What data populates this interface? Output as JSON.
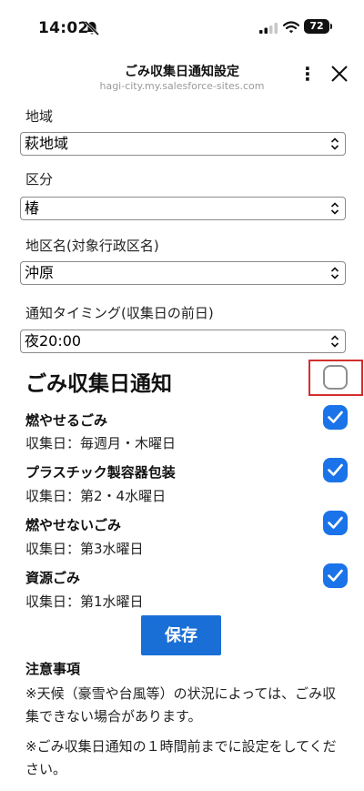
{
  "status_bar": {
    "time": "14:02",
    "battery": "72"
  },
  "browser": {
    "title": "ごみ収集日通知設定",
    "url": "hagi-city.my.salesforce-sites.com"
  },
  "form": {
    "region": {
      "label": "地域",
      "value": "萩地域"
    },
    "category": {
      "label": "区分",
      "value": "椿"
    },
    "district": {
      "label": "地区名(対象行政区名)",
      "value": "沖原"
    },
    "timing": {
      "label": "通知タイミング(収集日の前日)",
      "value": "夜20:00"
    }
  },
  "notification": {
    "title": "ごみ収集日通知",
    "master_checked": false,
    "items": [
      {
        "name": "燃やせるごみ",
        "date": "収集日：毎週月・木曜日",
        "checked": true
      },
      {
        "name": "プラスチック製容器包装",
        "date": "収集日：第2・4水曜日",
        "checked": true
      },
      {
        "name": "燃やせないごみ",
        "date": "収集日：第3水曜日",
        "checked": true
      },
      {
        "name": "資源ごみ",
        "date": "収集日：第1水曜日",
        "checked": true
      }
    ]
  },
  "save_label": "保存",
  "notes": {
    "title": "注意事項",
    "lines": [
      "※天候（豪雪や台風等）の状況によっては、ごみ収集できない場合があります。",
      "※ごみ収集日通知の１時間前までに設定をしてください。"
    ]
  },
  "colors": {
    "accent": "#1a73e8",
    "save_button": "#1a6fd6",
    "highlight_frame": "#d32f2f"
  },
  "icons": [
    "bell-off-icon",
    "signal-icon",
    "wifi-icon",
    "battery-icon",
    "more-vertical-icon",
    "close-icon",
    "chevron-updown-icon",
    "checkmark-icon"
  ]
}
